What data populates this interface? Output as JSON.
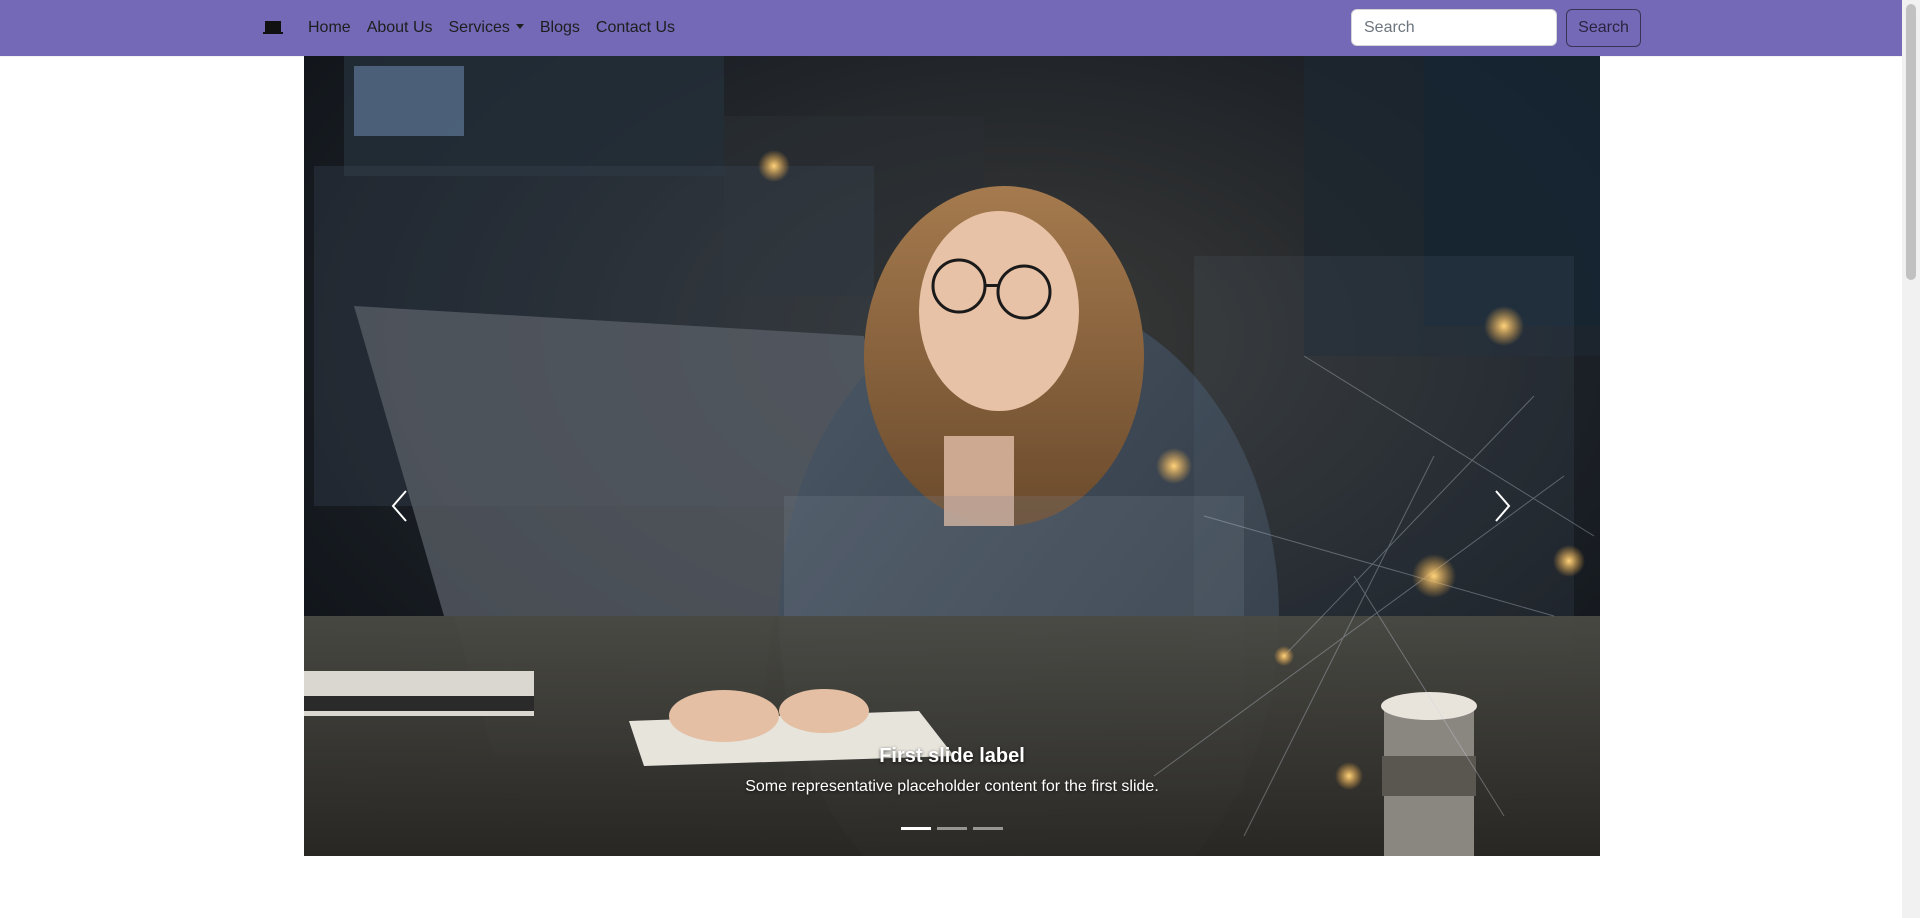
{
  "navbar": {
    "background": "#7469b6",
    "brand_icon": "laptop-icon",
    "links": [
      {
        "label": "Home"
      },
      {
        "label": "About Us"
      },
      {
        "label": "Services",
        "dropdown": true
      },
      {
        "label": "Blogs"
      },
      {
        "label": "Contact Us"
      }
    ],
    "search": {
      "placeholder": "Search",
      "value": "",
      "button_label": "Search"
    }
  },
  "carousel": {
    "active_index": 0,
    "slide_count": 3,
    "slides": [
      {
        "title": "First slide label",
        "text": "Some representative placeholder content for the first slide."
      }
    ],
    "prev_icon": "chevron-left-icon",
    "next_icon": "chevron-right-icon"
  },
  "colors": {
    "nav_bg": "#7469b6",
    "search_border": "#3b3357"
  }
}
